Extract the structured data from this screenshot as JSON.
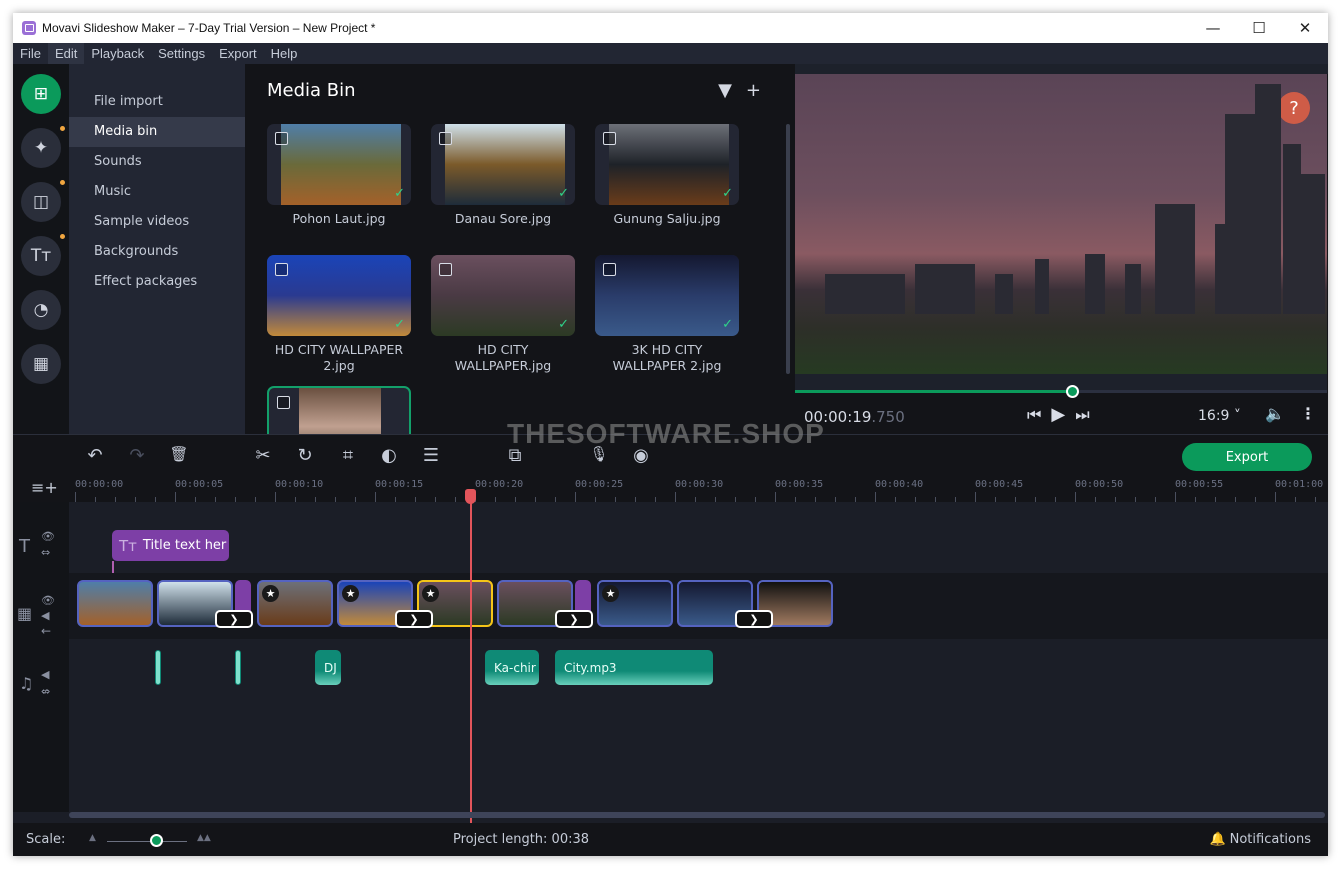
{
  "window": {
    "title": "Movavi Slideshow Maker – 7-Day Trial Version – New Project *",
    "controls": {
      "minimize": "—",
      "maximize": "☐",
      "close": "✕"
    }
  },
  "menu": [
    {
      "label": "File",
      "active": false
    },
    {
      "label": "Edit",
      "active": true
    },
    {
      "label": "Playback",
      "active": false
    },
    {
      "label": "Settings",
      "active": false
    },
    {
      "label": "Export",
      "active": false
    },
    {
      "label": "Help",
      "active": false
    }
  ],
  "leftbar": [
    {
      "icon": "import-icon",
      "glyph": "⊞",
      "active": true,
      "dot": false
    },
    {
      "icon": "magic-wand-icon",
      "glyph": "✦",
      "active": false,
      "dot": true
    },
    {
      "icon": "transitions-icon",
      "glyph": "◫",
      "active": false,
      "dot": true
    },
    {
      "icon": "titles-icon",
      "glyph": "Tт",
      "active": false,
      "dot": true
    },
    {
      "icon": "stickers-icon",
      "glyph": "◔",
      "active": false,
      "dot": false
    },
    {
      "icon": "more-tools-icon",
      "glyph": "▦",
      "active": false,
      "dot": false
    }
  ],
  "nav": [
    {
      "label": "File import",
      "active": false
    },
    {
      "label": "Media bin",
      "active": true
    },
    {
      "label": "Sounds",
      "active": false
    },
    {
      "label": "Music",
      "active": false
    },
    {
      "label": "Sample videos",
      "active": false
    },
    {
      "label": "Backgrounds",
      "active": false
    },
    {
      "label": "Effect packages",
      "active": false
    }
  ],
  "media_bin": {
    "title": "Media Bin",
    "filter_icon": "▼",
    "add_icon": "+",
    "items": [
      {
        "name": "Pohon Laut.jpg",
        "used": true,
        "colors": [
          "#4f7ea8",
          "#6a6a3a",
          "#a4612a"
        ]
      },
      {
        "name": "Danau Sore.jpg",
        "used": true,
        "colors": [
          "#cfe0ea",
          "#7b5a2a",
          "#1e2c3a"
        ]
      },
      {
        "name": "Gunung Salju.jpg",
        "used": true,
        "colors": [
          "#6d7078",
          "#1e2228",
          "#6a3c1a"
        ]
      },
      {
        "name": "HD CITY WALLPAPER 2.jpg",
        "used": true,
        "colors": [
          "#1a44b8",
          "#2a3a90",
          "#c28a3a"
        ]
      },
      {
        "name": "HD CITY WALLPAPER.jpg",
        "used": true,
        "colors": [
          "#6a4f5e",
          "#4a3a44",
          "#2c3a24"
        ]
      },
      {
        "name": "3K HD CITY WALLPAPER 2.jpg",
        "used": true,
        "colors": [
          "#141830",
          "#2a3c6a",
          "#3a5a8a"
        ]
      },
      {
        "name": "",
        "used": false,
        "selected": true,
        "colors": [
          "#6a5040",
          "#c0a090",
          "#3a3020"
        ]
      }
    ]
  },
  "preview": {
    "help": "?",
    "progress": 0.52,
    "time_main": "00:00:19",
    "time_ms": ".750",
    "prev_icon": "⏮",
    "play_icon": "▶",
    "next_icon": "⏭",
    "aspect_ratio": "16:9 ˅",
    "volume_icon": "🔈",
    "more_icon": "⋮"
  },
  "watermark": "THESOFTWARE.SHOP",
  "toolbar": {
    "undo": "↶",
    "redo": "↷",
    "delete": "🗑",
    "cut": "✂",
    "rotate": "↻",
    "crop": "⌗",
    "color": "◐",
    "adjust": "☰",
    "transition": "⧉",
    "record_audio": "🎙",
    "webcam": "◉",
    "export_label": "Export"
  },
  "timeline": {
    "add_track_icon": "≡+",
    "ticks": [
      "00:00:00",
      "00:00:05",
      "00:00:10",
      "00:00:15",
      "00:00:20",
      "00:00:25",
      "00:00:30",
      "00:00:35",
      "00:00:40",
      "00:00:45",
      "00:00:50",
      "00:00:55",
      "00:01:00"
    ],
    "playhead_seconds": 19.75,
    "title_clip": {
      "icon": "Tт",
      "text": "Title text her"
    },
    "video_clips": [
      {
        "star": false,
        "current": false,
        "colors": [
          "#4f7ea8",
          "#a4612a"
        ]
      },
      {
        "star": false,
        "current": false,
        "colors": [
          "#cfe0ea",
          "#1e2c3a"
        ]
      },
      {
        "star": true,
        "current": false,
        "colors": [
          "#6d7078",
          "#6a3c1a"
        ]
      },
      {
        "star": true,
        "current": false,
        "colors": [
          "#1a44b8",
          "#c28a3a"
        ]
      },
      {
        "star": true,
        "current": true,
        "colors": [
          "#6a4f5e",
          "#2c3a24"
        ]
      },
      {
        "star": false,
        "current": false,
        "colors": [
          "#6a4f5e",
          "#2c3a24"
        ]
      },
      {
        "star": true,
        "current": false,
        "colors": [
          "#141830",
          "#3a5a8a"
        ]
      },
      {
        "star": false,
        "current": false,
        "colors": [
          "#141830",
          "#3a5a8a"
        ]
      },
      {
        "star": false,
        "current": false,
        "colors": [
          "#111",
          "#a07a60"
        ]
      }
    ],
    "audio_clips": [
      {
        "label": ""
      },
      {
        "label": ""
      },
      {
        "label": "DJ"
      },
      {
        "label": "Ka-chir"
      },
      {
        "label": "City.mp3"
      }
    ]
  },
  "status": {
    "scale_label": "Scale:",
    "project_length": "Project length:  00:38",
    "notifications": "Notifications"
  }
}
